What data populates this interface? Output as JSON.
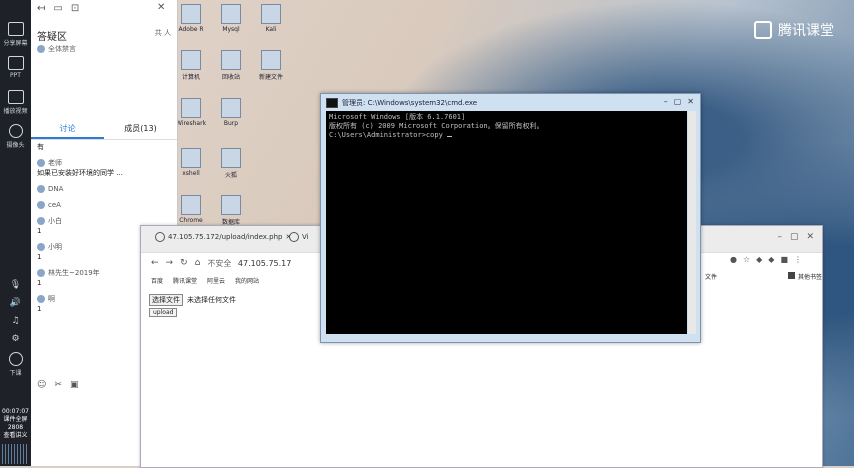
{
  "brand": {
    "text": "腾讯课堂"
  },
  "leftbar": {
    "items": [
      {
        "label": "分享屏幕"
      },
      {
        "label": "PPT"
      },
      {
        "label": "播放视频"
      },
      {
        "label": "摄像头"
      }
    ],
    "bottom_label": "下课",
    "time": "00:07:07",
    "status1": "课件全屏",
    "status2": "2808",
    "status3": "查看讲义"
  },
  "chat": {
    "title": "答疑区",
    "sub": "全体禁言",
    "right_info": "共 人",
    "tabs": [
      {
        "label": "讨论"
      },
      {
        "label": "成员(13)"
      }
    ],
    "messages": [
      {
        "who": "",
        "text": "有"
      },
      {
        "who": "老师",
        "text": "如果已安装好环境的同学 ..."
      },
      {
        "who": "DNA",
        "text": ""
      },
      {
        "who": "ceA",
        "text": ""
      },
      {
        "who": "小白",
        "text": "1"
      },
      {
        "who": "小明",
        "text": "1"
      },
      {
        "who": "林先生~2019年",
        "text": "1"
      },
      {
        "who": "啊",
        "text": "1"
      }
    ]
  },
  "cmd": {
    "title": "管理员: C:\\Windows\\system32\\cmd.exe",
    "lines": [
      "Microsoft Windows [版本 6.1.7601]",
      "版权所有 (c) 2009 Microsoft Corporation。保留所有权利。",
      "",
      "C:\\Users\\Administrator>copy "
    ]
  },
  "browser": {
    "tab1": "47.105.75.172/upload/index.php",
    "tab2": "Vi",
    "url_ns": "不安全",
    "url": "47.105.75.17",
    "bookmarks": [
      "百度",
      "腾讯课堂",
      "阿里云",
      "我的网站"
    ],
    "left_bm": "文件",
    "right_bm": "其他书签",
    "file_button": "选择文件",
    "file_label": "未选择任何文件",
    "upload": "upload"
  },
  "desktop_icons": [
    "Adobe R",
    "Mysql",
    "Kali",
    "计算机",
    "回收站",
    "新建文件",
    "Wireshark",
    "Burp",
    "xshell",
    "火狐",
    "Chrome",
    "数据库"
  ]
}
